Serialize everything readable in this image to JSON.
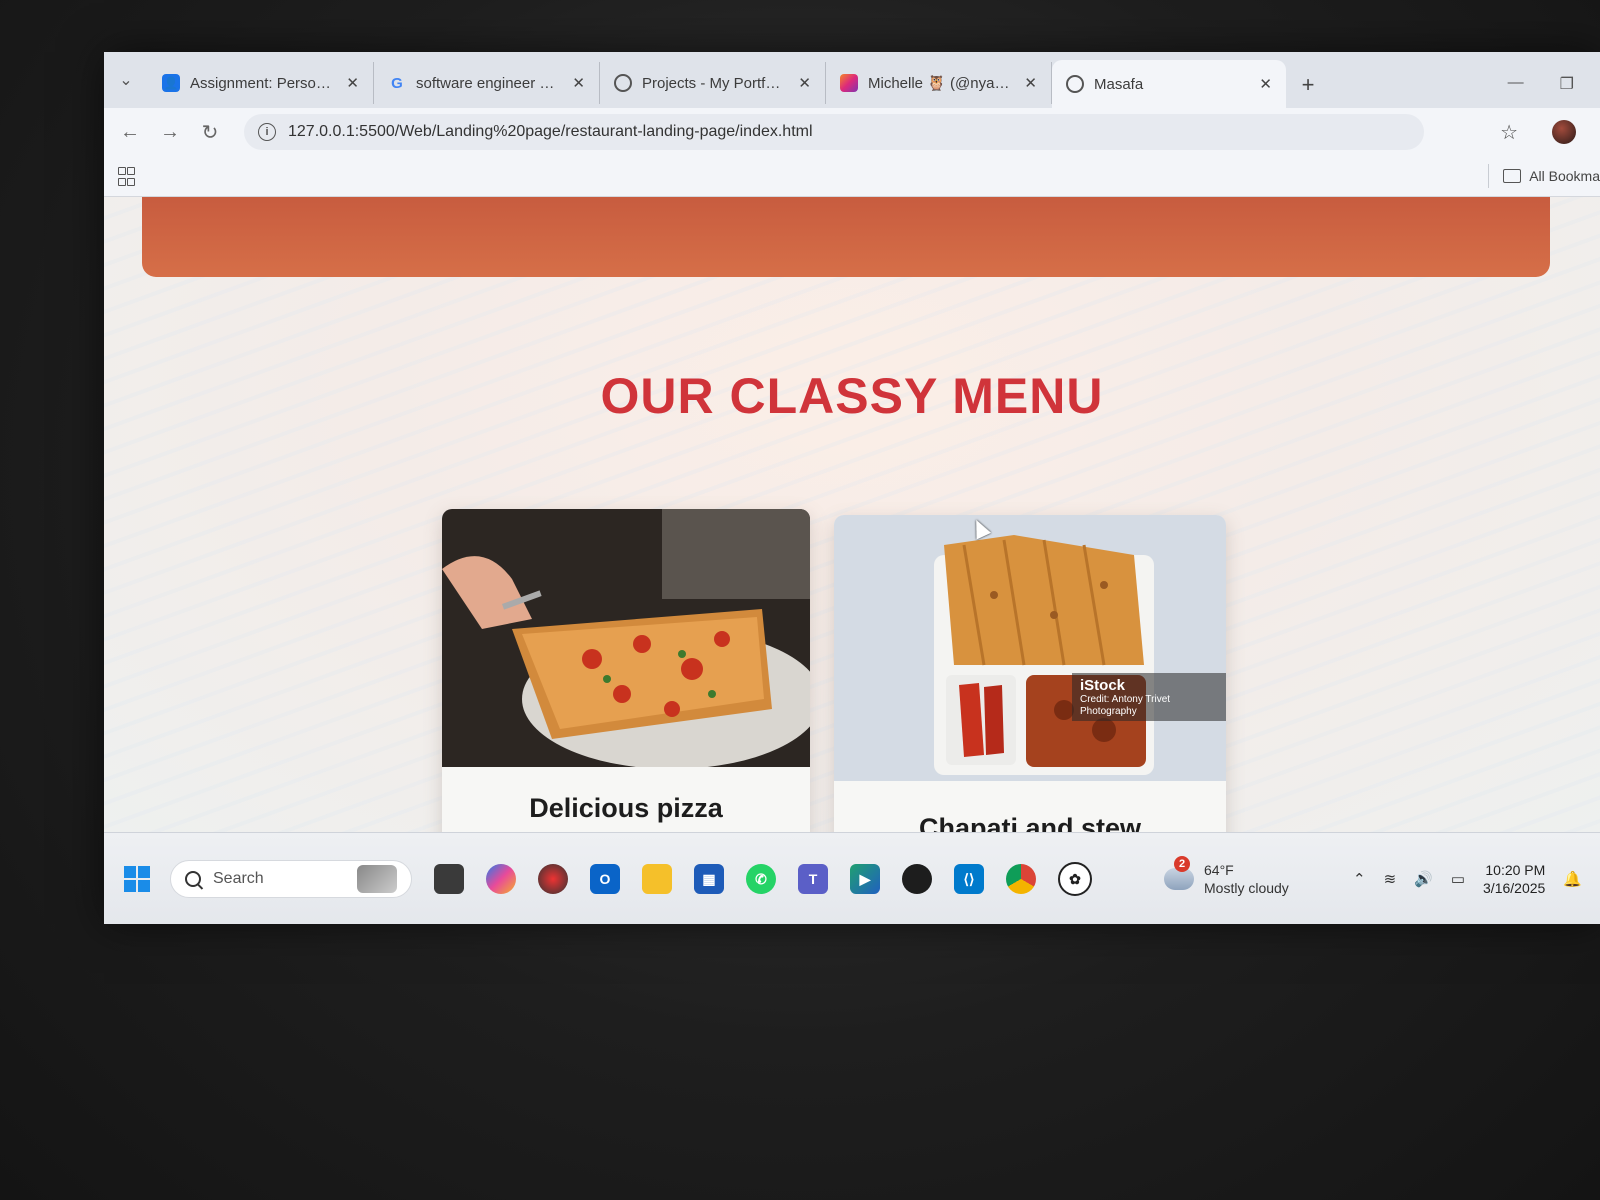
{
  "browser": {
    "tabs": [
      {
        "title": "Assignment: Personal Po",
        "icon": "classroom-icon",
        "icon_color": "#1a73e8",
        "active": false
      },
      {
        "title": "software engineer portfo",
        "icon": "google-icon",
        "icon_color": "#4285f4",
        "active": false
      },
      {
        "title": "Projects - My Portfolio",
        "icon": "globe-icon",
        "icon_color": "#5f6368",
        "active": false
      },
      {
        "title": "Michelle 🦉 (@nyari.bari",
        "icon": "instagram-icon",
        "icon_color": "#e1306c",
        "active": false
      },
      {
        "title": "Masafa",
        "icon": "globe-icon",
        "icon_color": "#5f6368",
        "active": true
      }
    ],
    "new_tab_label": "+",
    "url": "127.0.0.1:5500/Web/Landing%20page/restaurant-landing-page/index.html",
    "bookmarks_label": "All Bookma"
  },
  "page": {
    "banner_color": "#cf6443",
    "section_title": "OUR CLASSY MENU",
    "title_color": "#d0343a",
    "menu_items": [
      {
        "label": "Delicious pizza",
        "image": "pizza-photo"
      },
      {
        "label": "Chapati and stew",
        "image": "chapati-stew-photo"
      }
    ],
    "watermark": {
      "brand": "iStock",
      "credit": "Credit: Antony Trivet Photography"
    }
  },
  "taskbar": {
    "search_placeholder": "Search",
    "apps": [
      "task-view-icon",
      "copilot-icon",
      "kodi-icon",
      "outlook-icon",
      "file-explorer-icon",
      "ms-store-icon",
      "whatsapp-icon",
      "teams-icon",
      "media-player-icon",
      "github-icon",
      "vscode-icon",
      "chrome-icon",
      "chatgpt-icon"
    ],
    "weather": {
      "badge": "2",
      "temp": "64°F",
      "condition": "Mostly cloudy"
    },
    "time": "10:20 PM",
    "date": "3/16/2025"
  }
}
